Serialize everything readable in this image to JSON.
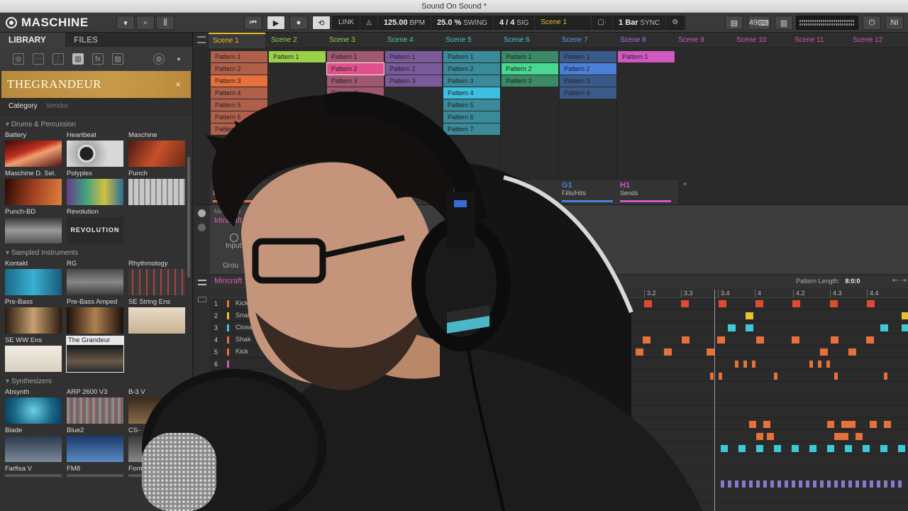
{
  "window": {
    "title": "Sound On Sound *"
  },
  "toolbar": {
    "logo": "MASCHINE",
    "link": "LINK",
    "bpm_value": "125.00",
    "bpm_label": "BPM",
    "swing_value": "25.0 %",
    "swing_label": "SWING",
    "sig_value": "4 / 4",
    "sig_label": "SIG",
    "scene": "Scene 1",
    "grid_value": "1 Bar",
    "sync": "SYNC",
    "cpu_label": "CPU",
    "keys_count": "49"
  },
  "browser": {
    "tabs": [
      "LIBRARY",
      "FILES"
    ],
    "banner": "THEGRANDEUR",
    "banner_close": "×",
    "category": "Category",
    "vendor": "Vendor",
    "sections": [
      {
        "title": "Drums & Percussion",
        "items": [
          "Battery",
          "Heartbeat",
          "Maschine",
          "Maschine D. Sel.",
          "Polyplex",
          "Punch",
          "Punch-BD",
          "Revolution"
        ]
      },
      {
        "title": "Sampled Instruments",
        "items": [
          "Kontakt",
          "RG",
          "Rhythmology",
          "Pre-Bass",
          "Pre-Bass Amped",
          "SE String Ens",
          "SE WW Ens",
          "The Grandeur"
        ]
      },
      {
        "title": "Synthesizers",
        "items": [
          "Absynth",
          "ARP 2600 V3",
          "B-3 V",
          "Blade",
          "Blue2",
          "CS-",
          "Farfisa V",
          "FM8",
          "Form"
        ]
      }
    ],
    "thumb_texts": {
      "revolution": "REVOLUTION"
    }
  },
  "scenes": [
    "Scene 1",
    "Scene 2",
    "Scene 3",
    "Scene 4",
    "Scene 5",
    "Scene 6",
    "Scene 7",
    "Scene 8",
    "Scene 9",
    "Scene 10",
    "Scene 11",
    "Scene 12"
  ],
  "scene_colors": [
    "#e8c22a",
    "#9ad04a",
    "#9ad04a",
    "#58c8a0",
    "#3ec8d8",
    "#3ec8d8",
    "#5a9ae8",
    "#b070e0",
    "#d058c0",
    "#d058c0",
    "#d058a8",
    "#d058a8"
  ],
  "patterns": [
    {
      "col": 0,
      "items": [
        "Pattern 1",
        "Pattern 2",
        "Pattern 3",
        "Pattern 4",
        "Pattern 5",
        "Pattern 6",
        "Pattern 7"
      ],
      "color": "#b0604a",
      "hl": 2,
      "hl_color": "#e8703a"
    },
    {
      "col": 1,
      "items": [
        "Pattern 1"
      ],
      "color": "#9ad04a"
    },
    {
      "col": 2,
      "items": [
        "Pattern 1",
        "Pattern 2",
        "Pattern 3",
        "Pattern 4",
        "Pattern 5"
      ],
      "color": "#a05870",
      "hl": 1,
      "hl_color": "#e0508a"
    },
    {
      "col": 3,
      "items": [
        "Pattern 1",
        "Pattern 2",
        "Pattern 3"
      ],
      "color": "#7a5a9a",
      "hl_color": "#8a68b0"
    },
    {
      "col": 4,
      "items": [
        "Pattern 1",
        "Pattern 2",
        "Pattern 3",
        "Pattern 4",
        "Pattern 5",
        "Pattern 6",
        "Pattern 7"
      ],
      "color": "#3a8a9a",
      "hl": 3,
      "hl_color": "#3cc0e0"
    },
    {
      "col": 5,
      "items": [
        "Pattern 1",
        "Pattern 2",
        "Pattern 3"
      ],
      "color": "#3a8a68",
      "hl": 1,
      "hl_color": "#48d890"
    },
    {
      "col": 6,
      "items": [
        "Pattern 1",
        "Pattern 2",
        "Pattern 3",
        "Pattern 4"
      ],
      "color": "#3a5a8a",
      "hl": 1,
      "hl_color": "#4a80d8"
    },
    {
      "col": 7,
      "items": [
        "Pattern 1"
      ],
      "color": "#d058c0"
    }
  ],
  "groups": [
    {
      "letter": "A1",
      "name": "Drums",
      "color": "#e8703a"
    },
    {
      "letter": "G1",
      "name": "Fills/Hits",
      "color": "#4a80d8"
    },
    {
      "letter": "H1",
      "name": "Sends",
      "color": "#d058c0"
    }
  ],
  "control": {
    "master": "MASTER",
    "sound": "Mincraft",
    "input": "Input",
    "group_label": "Grou"
  },
  "pattern_editor": {
    "name": "Mincraft",
    "length_label": "Pattern Length:",
    "length_value": "8:0:0",
    "ruler": [
      "2.4",
      "3",
      "3.2",
      "3.3",
      "3.4",
      "4",
      "4.2",
      "4.3",
      "4.4"
    ],
    "sounds": [
      {
        "n": "1",
        "name": "Kick Min",
        "color": "#e8703a"
      },
      {
        "n": "2",
        "name": "Snare M",
        "color": "#e8c22a"
      },
      {
        "n": "3",
        "name": "Closed",
        "color": "#3ec8d8"
      },
      {
        "n": "4",
        "name": "Shak",
        "color": "#e8703a"
      },
      {
        "n": "5",
        "name": "Kick",
        "color": "#e8703a"
      },
      {
        "n": "6",
        "name": "",
        "color": "#d058c0"
      },
      {
        "n": "7",
        "name": "",
        "color": "#e8703a"
      }
    ]
  }
}
